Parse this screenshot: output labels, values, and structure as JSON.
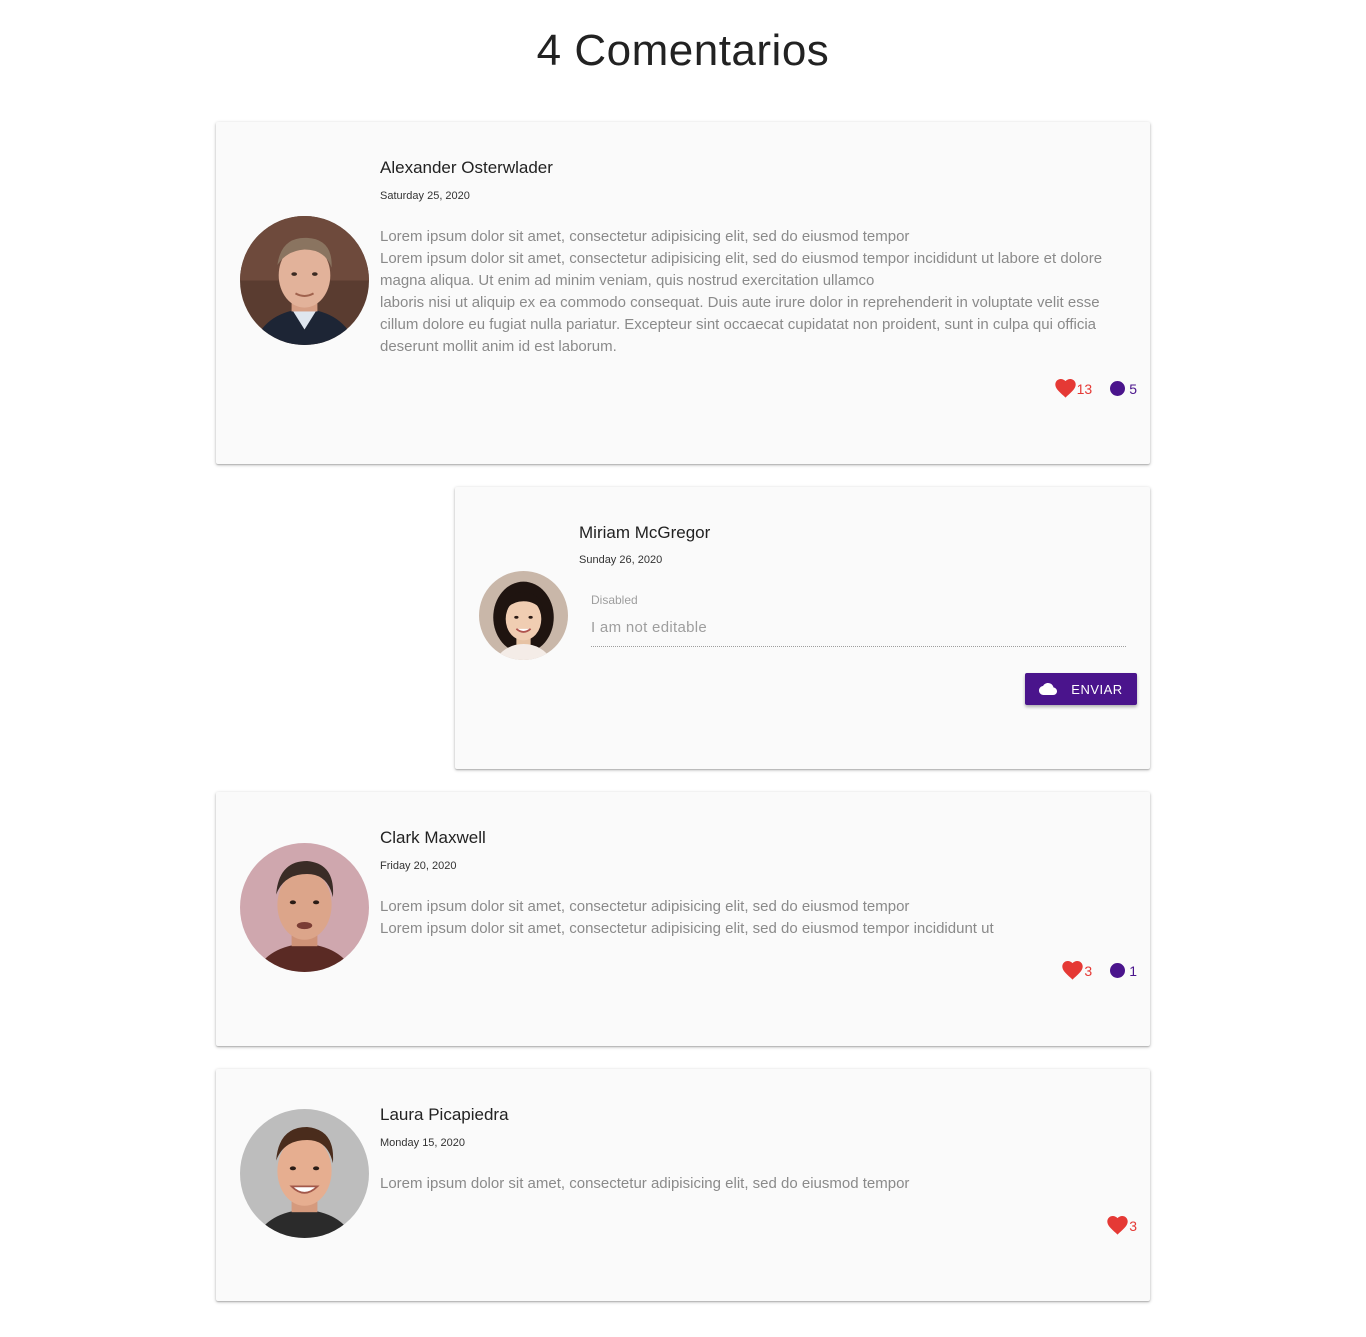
{
  "page": {
    "title": "4 Comentarios"
  },
  "colors": {
    "accent": "#4a148c",
    "heart": "#e53935",
    "card_bg": "#fafafa"
  },
  "comments": [
    {
      "author": "Alexander Osterwlader",
      "date": "Saturday 25, 2020",
      "lines": [
        "Lorem ipsum dolor sit amet, consectetur adipisicing elit, sed do eiusmod tempor",
        "Lorem ipsum dolor sit amet, consectetur adipisicing elit, sed do eiusmod tempor incididunt ut labore et dolore magna aliqua. Ut enim ad minim veniam, quis nostrud exercitation ullamco",
        "laboris nisi ut aliquip ex ea commodo consequat. Duis aute irure dolor in reprehenderit in voluptate velit esse cillum dolore eu fugiat nulla pariatur. Excepteur sint occaecat cupidatat non proident, sunt in culpa qui officia deserunt mollit anim id est laborum."
      ],
      "likes": "13",
      "replies": "5"
    },
    {
      "author": "Miriam McGregor",
      "date": "Sunday 26, 2020",
      "field_label": "Disabled",
      "field_value": "I am not editable",
      "button_label": "ENVIAR"
    },
    {
      "author": "Clark Maxwell",
      "date": "Friday 20, 2020",
      "lines": [
        "Lorem ipsum dolor sit amet, consectetur adipisicing elit, sed do eiusmod tempor",
        "Lorem ipsum dolor sit amet, consectetur adipisicing elit, sed do eiusmod tempor incididunt ut"
      ],
      "likes": "3",
      "replies": "1"
    },
    {
      "author": "Laura Picapiedra",
      "date": "Monday 15, 2020",
      "lines": [
        "Lorem ipsum dolor sit amet, consectetur adipisicing elit, sed do eiusmod tempor"
      ],
      "likes": "3"
    }
  ]
}
